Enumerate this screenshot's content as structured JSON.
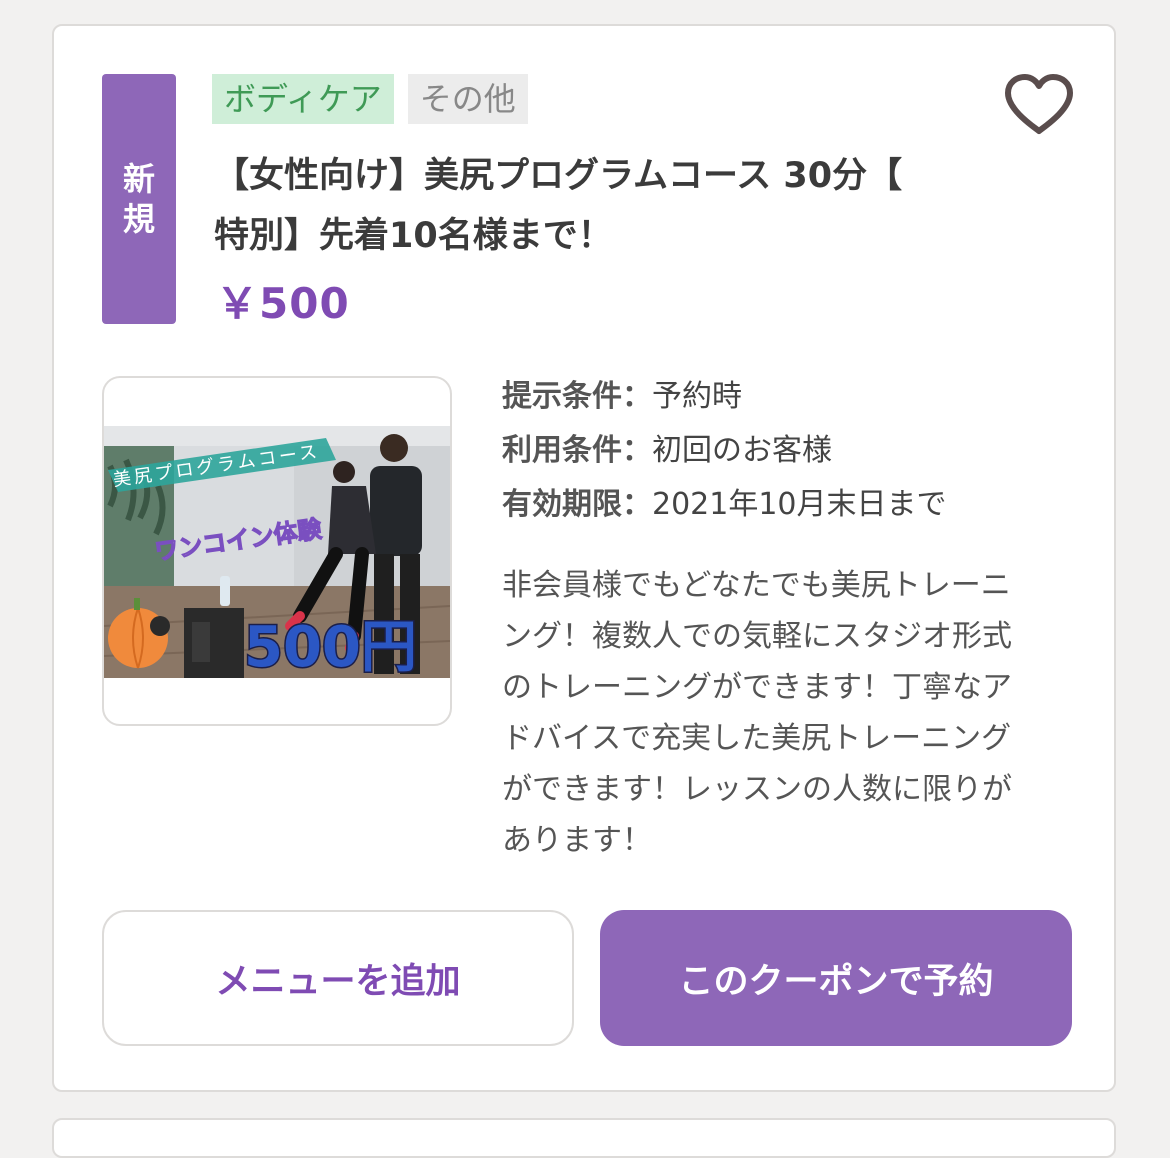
{
  "coupon": {
    "badge_line1": "新",
    "badge_line2": "規",
    "tags": [
      "ボディケア",
      "その他"
    ],
    "title_line1": "【女性向け】美尻プログラムコース 30分【",
    "title_line2": "特別】先着10名様まで！",
    "price": "￥500",
    "conditions": [
      {
        "label": "提示条件",
        "value": "予約時"
      },
      {
        "label": "利用条件",
        "value": "初回のお客様"
      },
      {
        "label": "有効期限",
        "value": "2021年10月末日まで"
      }
    ],
    "separator": "：",
    "description_lines": [
      "非会員様でもどなたでも美尻トレーニ",
      "ング！複数人での気軽にスタジオ形式",
      "のトレーニングができます！丁寧なア",
      "ドバイスで充実した美尻トレーニング",
      "ができます！レッスンの人数に限りが",
      "あります！"
    ],
    "image": {
      "banner_text": "美尻プログラムコース",
      "sub_text": "ワンコイン体験",
      "price_text": "500円"
    }
  },
  "buttons": {
    "add_menu": "メニューを追加",
    "book": "このクーポンで予約"
  },
  "colors": {
    "accent": "#8e67b8",
    "price": "#7f4bb3",
    "tag_green_bg": "#cfeed8",
    "tag_green_text": "#3f9a56"
  },
  "icons": {
    "favorite": "heart-outline-icon"
  }
}
